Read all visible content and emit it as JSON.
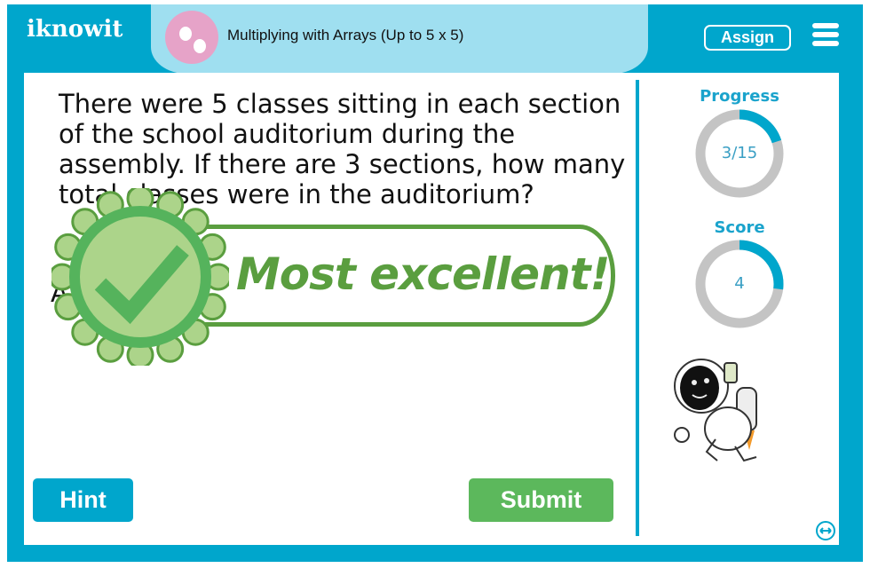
{
  "header": {
    "logo": "iknowit",
    "title": "Multiplying with Arrays (Up to 5 x 5)",
    "assign_label": "Assign",
    "menu_icon": "hamburger-icon"
  },
  "question": {
    "text": "There were 5 classes sitting in each section of the school auditorium during the assembly. If there are 3 sections, how many total classes were in the auditorium?",
    "answer_label_visible": "A"
  },
  "feedback": {
    "message": "Most excellent!",
    "icon": "check-seal-icon"
  },
  "progress": {
    "label": "Progress",
    "value": "3/15",
    "fraction": 0.2
  },
  "score": {
    "label": "Score",
    "value": "4",
    "fraction": 0.27
  },
  "buttons": {
    "hint": "Hint",
    "submit": "Submit"
  },
  "colors": {
    "brand_blue": "#00a6cc",
    "pill_blue": "#9fdff0",
    "success_green": "#5cb85c",
    "banner_green": "#5a9e3f",
    "ring_gray": "#c4c4c4"
  }
}
